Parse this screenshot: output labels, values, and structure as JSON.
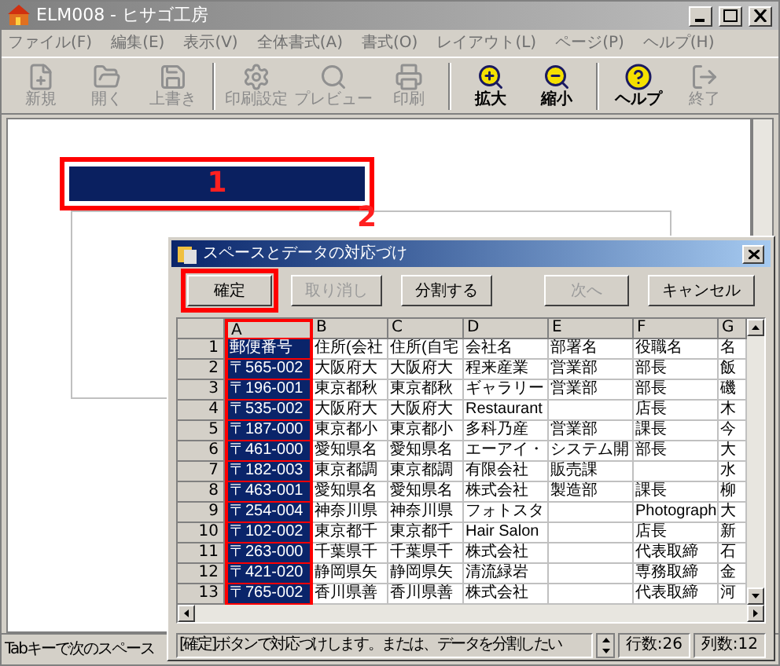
{
  "window": {
    "title": "ELM008 - ヒサゴ工房"
  },
  "menu": [
    "ファイル(F)",
    "編集(E)",
    "表示(V)",
    "全体書式(A)",
    "書式(O)",
    "レイアウト(L)",
    "ページ(P)",
    "ヘルプ(H)"
  ],
  "toolbar_groups": [
    [
      {
        "label": "新規",
        "kind": "new",
        "disabled": true
      },
      {
        "label": "開く",
        "kind": "open",
        "disabled": true
      },
      {
        "label": "上書き",
        "kind": "save",
        "disabled": true
      }
    ],
    [
      {
        "label": "印刷設定",
        "kind": "setup",
        "disabled": true
      },
      {
        "label": "プレビュー",
        "kind": "preview",
        "disabled": true
      },
      {
        "label": "印刷",
        "kind": "print",
        "disabled": true
      }
    ],
    [
      {
        "label": "拡大",
        "kind": "zoomin",
        "disabled": false
      },
      {
        "label": "縮小",
        "kind": "zoomout",
        "disabled": false
      }
    ],
    [
      {
        "label": "ヘルプ",
        "kind": "help",
        "disabled": false
      },
      {
        "label": "終了",
        "kind": "exit",
        "disabled": true
      }
    ]
  ],
  "annotations": [
    "1",
    "2"
  ],
  "status_bar": "Tabキーで次のスペース",
  "dialog": {
    "title": "スペースとデータの対応づけ",
    "buttons": [
      {
        "label": "確定",
        "disabled": false,
        "highlighted": true
      },
      {
        "label": "取り消し",
        "disabled": true,
        "highlighted": false
      },
      {
        "label": "分割する",
        "disabled": false,
        "highlighted": false
      }
    ],
    "nav_buttons": [
      {
        "label": "次へ",
        "disabled": true,
        "highlighted": false
      },
      {
        "label": "キャンセル",
        "disabled": false,
        "highlighted": false
      }
    ],
    "grid": {
      "columns": [
        {
          "label": "A",
          "selected": true
        },
        {
          "label": "B",
          "selected": false
        },
        {
          "label": "C",
          "selected": false
        },
        {
          "label": "D",
          "selected": false
        },
        {
          "label": "E",
          "selected": false
        },
        {
          "label": "F",
          "selected": false
        },
        {
          "label": "G",
          "selected": false
        }
      ],
      "rows": [
        {
          "number": "1",
          "cells": [
            "郵便番号",
            "住所(会社",
            "住所(自宅",
            "会社名",
            "部署名",
            "役職名",
            "名"
          ]
        },
        {
          "number": "2",
          "cells": [
            "〒565-002",
            "大阪府大",
            "大阪府大",
            "程来産業",
            "営業部",
            "部長",
            "飯"
          ]
        },
        {
          "number": "3",
          "cells": [
            "〒196-001",
            "東京都秋",
            "東京都秋",
            "ギャラリー",
            "営業部",
            "部長",
            "磯"
          ]
        },
        {
          "number": "4",
          "cells": [
            "〒535-002",
            "大阪府大",
            "大阪府大",
            "Restaurant",
            null,
            "店長",
            "木"
          ]
        },
        {
          "number": "5",
          "cells": [
            "〒187-000",
            "東京都小",
            "東京都小",
            "多科乃産",
            "営業部",
            "課長",
            "今"
          ]
        },
        {
          "number": "6",
          "cells": [
            "〒461-000",
            "愛知県名",
            "愛知県名",
            "エーアイ・",
            "システム開",
            "部長",
            "大"
          ]
        },
        {
          "number": "7",
          "cells": [
            "〒182-003",
            "東京都調",
            "東京都調",
            "有限会社",
            "販売課",
            null,
            "水"
          ]
        },
        {
          "number": "8",
          "cells": [
            "〒463-001",
            "愛知県名",
            "愛知県名",
            "株式会社",
            "製造部",
            "課長",
            "柳"
          ]
        },
        {
          "number": "9",
          "cells": [
            "〒254-004",
            "神奈川県",
            "神奈川県",
            "フォトスタ",
            null,
            "Photograph",
            "大"
          ]
        },
        {
          "number": "10",
          "cells": [
            "〒102-002",
            "東京都千",
            "東京都千",
            "Hair Salon",
            null,
            "店長",
            "新"
          ]
        },
        {
          "number": "11",
          "cells": [
            "〒263-000",
            "千葉県千",
            "千葉県千",
            "株式会社",
            null,
            "代表取締",
            "石"
          ]
        },
        {
          "number": "12",
          "cells": [
            "〒421-020",
            "静岡県矢",
            "静岡県矢",
            "清流緑岩",
            null,
            "専務取締",
            "金"
          ]
        },
        {
          "number": "13",
          "cells": [
            "〒765-002",
            "香川県善",
            "香川県善",
            "株式会社",
            null,
            "代表取締",
            "河"
          ]
        }
      ]
    },
    "message": "[確定]ボタンで対応づけします。または、データを分割したい",
    "row_count": "行数:26",
    "column_count": "列数:12"
  }
}
